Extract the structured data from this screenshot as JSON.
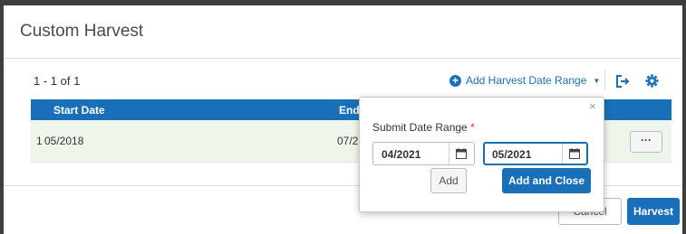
{
  "dialog": {
    "title": "Custom Harvest"
  },
  "toolbar": {
    "record_count": "1 - 1 of 1",
    "add_range_label": "Add Harvest Date Range",
    "icons": [
      "plus-circle-icon",
      "caret-down-icon",
      "export-icon",
      "gear-icon"
    ]
  },
  "table": {
    "columns": [
      "Start Date",
      "End"
    ],
    "rows": [
      {
        "index": "1",
        "start": "05/2018",
        "end": "07/2",
        "action_label": "···"
      }
    ]
  },
  "popover": {
    "close_label": "×",
    "label": "Submit Date Range",
    "required_mark": "*",
    "from_value": "04/2021",
    "to_value": "05/2021",
    "add_label": "Add",
    "add_close_label": "Add and Close"
  },
  "footer": {
    "cancel_label": "Cancel",
    "harvest_label": "Harvest"
  },
  "colors": {
    "primary": "#1a70b8",
    "row_background": "#eef6ec",
    "required": "#d9302c"
  }
}
